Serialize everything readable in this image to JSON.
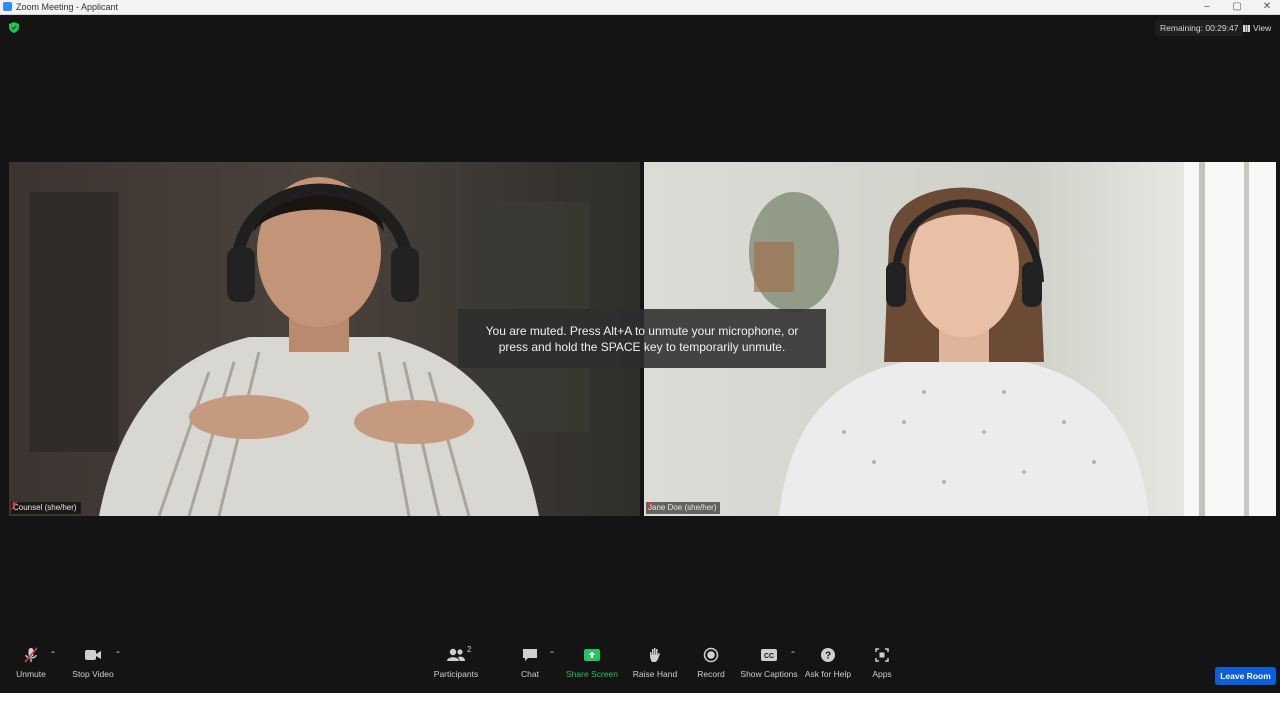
{
  "window": {
    "title": "Zoom Meeting - Applicant",
    "controls": [
      "–",
      "▢",
      "✕"
    ]
  },
  "header": {
    "remaining": "Remaining: 00:29:47",
    "view_label": "View"
  },
  "participants": [
    {
      "name": "Counsel (she/her)",
      "muted": true
    },
    {
      "name": "Jane Doe (she/her)",
      "muted": true
    }
  ],
  "toast": {
    "line1": "You are muted. Press Alt+A to unmute your microphone, or",
    "line2": "press and hold the SPACE key to temporarily unmute."
  },
  "toolbar": {
    "unmute": "Unmute",
    "stop_video": "Stop Video",
    "participants": "Participants",
    "participants_count": "2",
    "chat": "Chat",
    "share_screen": "Share Screen",
    "raise_hand": "Raise Hand",
    "record": "Record",
    "show_captions": "Show Captions",
    "ask_for_help": "Ask for Help",
    "apps": "Apps",
    "leave_room": "Leave Room"
  },
  "colors": {
    "stage": "#141414",
    "share_green": "#22c55e",
    "leave_blue": "#0e5edb",
    "muted_red": "#d93a3a"
  }
}
